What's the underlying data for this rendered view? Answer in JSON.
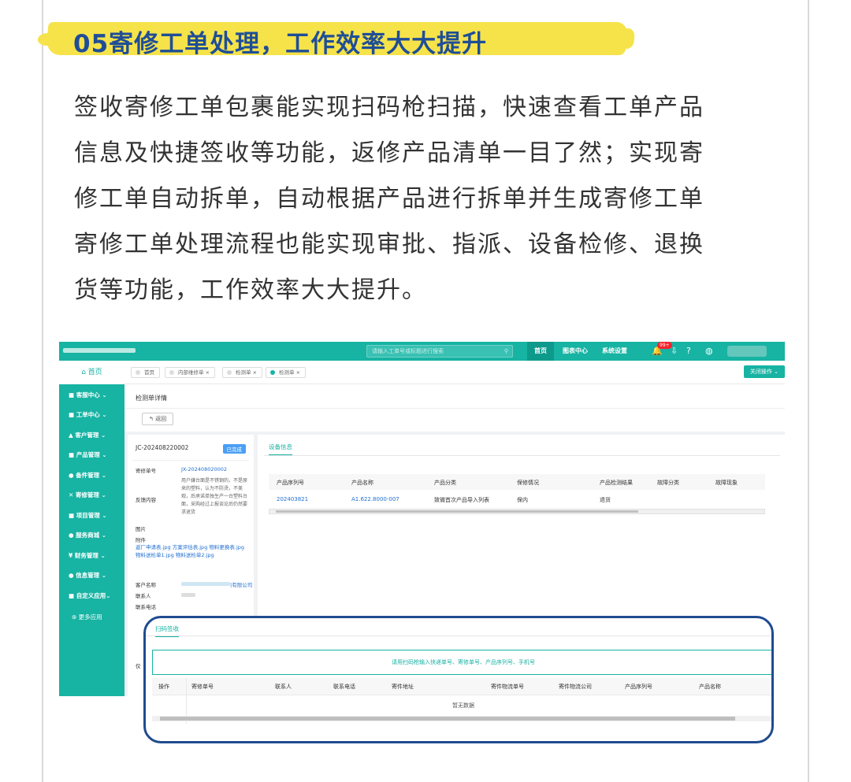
{
  "heading": "05寄修工单处理，工作效率大大提升",
  "paragraph": [
    "签收寄修工单包裹能实现扫码枪扫描，快速查看工单产品",
    "信息及快捷签收等功能，返修产品清单一目了然；实现寄",
    "修工单自动拆单，自动根据产品进行拆单并生成寄修工单",
    "寄修工单处理流程也能实现审批、指派、设备检修、退换",
    "货等功能，工作效率大大提升。"
  ],
  "app": {
    "search_placeholder": "请输入工单号或标题进行搜索",
    "nav": [
      "首页",
      "图表中心",
      "系统设置"
    ],
    "badge": "99+",
    "home": "首页",
    "sidebar": [
      "客服中心",
      "工单中心",
      "客户管理",
      "产品管理",
      "备件管理",
      "寄修管理",
      "项目管理",
      "服务商城",
      "财务管理",
      "信息管理",
      "自定义应用",
      "更多应用"
    ],
    "tabs": [
      "首页",
      "内部维修单",
      "检测单",
      "检测单"
    ],
    "close_ops": "关闭操作",
    "page_title": "检测单详情",
    "back": "返回",
    "order_id": "JC-202408220002",
    "status": "已完成",
    "fields": {
      "repair_no_label": "寄修单号",
      "repair_no": "JX-202408020002",
      "feedback_label": "反馈内容",
      "feedback": "用户嫌台面是不锈钢的，不是原来的塑料，认为不防烫，不美观，后承诺单独生产一台塑料台面，采购经过上报谈论后仍然要求退货",
      "image_label": "图片",
      "attach_label": "附件",
      "attachments": "返厂申请表.jpg  方案评估表.jpg  物料更换表.jpg  物料送检单1.jpg  物料送检单2.jpg",
      "customer_label": "客户名称",
      "customer_suffix": "|有限公司",
      "contact_label": "联系人",
      "phone_label": "联系电话",
      "extra_label": "仅"
    },
    "device_tab": "设备信息",
    "device_table": {
      "headers": [
        "产品序列号",
        "产品名称",
        "产品分类",
        "保修情况",
        "产品检测结果",
        "故障分类",
        "故障现象"
      ],
      "row": [
        "202403821",
        "A1.622.8000-007",
        "致微首次产品导入列表",
        "保内",
        "退货",
        "",
        ""
      ]
    },
    "scan": {
      "tab": "扫码签收",
      "placeholder": "请用扫码枪输入快递单号、寄修单号、产品序列号、手机号",
      "headers": [
        "操作",
        "寄修单号",
        "联系人",
        "联系电话",
        "寄件地址",
        "寄件物流单号",
        "寄件物流公司",
        "产品序列号",
        "产品名称"
      ],
      "empty": "暂无数据"
    }
  },
  "colors": {
    "accent": "#17b3a3",
    "heading": "#1f4e97",
    "highlight": "#f6e34a",
    "frame": "#1f4b8f"
  }
}
